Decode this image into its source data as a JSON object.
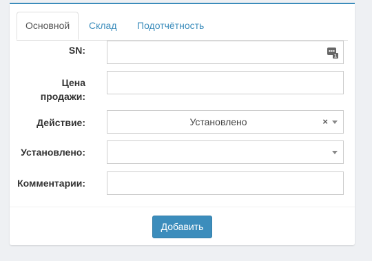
{
  "tabs": [
    {
      "label": "Основной",
      "active": true
    },
    {
      "label": "Склад",
      "active": false
    },
    {
      "label": "Подотчётность",
      "active": false
    }
  ],
  "form": {
    "sn": {
      "label": "SN:",
      "value": "",
      "icon": "sn-generator-icon"
    },
    "price": {
      "label_line1": "Цена",
      "label_line2": "продажи:",
      "value": ""
    },
    "action": {
      "label": "Действие:",
      "selected": "Установлено",
      "clear": "×"
    },
    "installed": {
      "label": "Установлено:",
      "selected": ""
    },
    "comment": {
      "label": "Комментарии:",
      "value": ""
    }
  },
  "submit_label": "Добавить",
  "colors": {
    "accent": "#3c8dbc",
    "button_border": "#367fa9"
  }
}
